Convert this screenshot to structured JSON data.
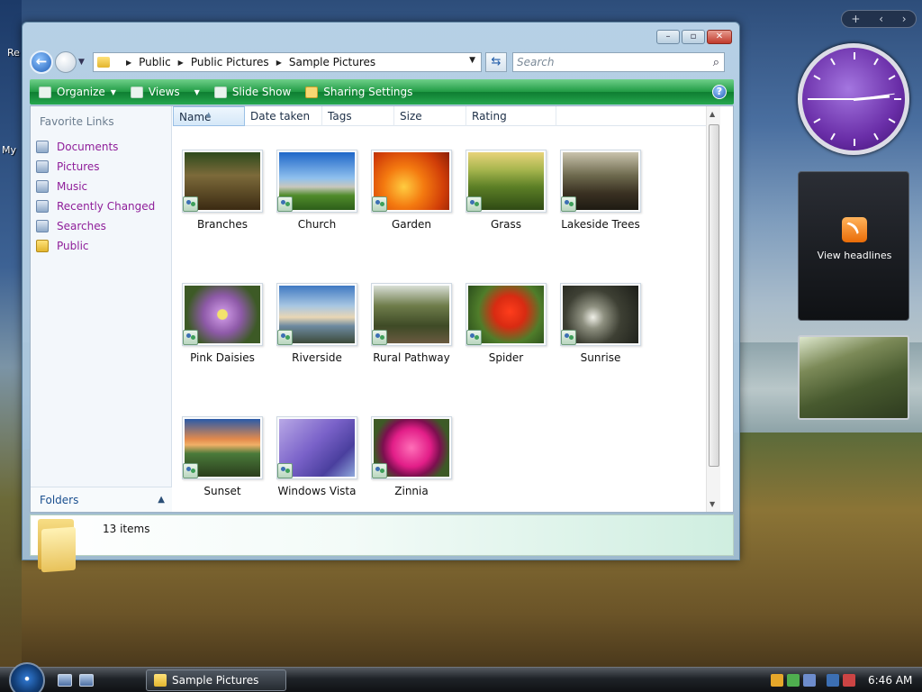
{
  "desktop": {
    "icon_label_1": "Re",
    "icon_label_2": "My"
  },
  "window": {
    "controls": {
      "minimize": "–",
      "maximize": "▫",
      "close": "✕"
    },
    "address": {
      "crumbs": [
        "Public",
        "Public Pictures",
        "Sample Pictures"
      ]
    },
    "search_placeholder": "Search",
    "toolbar": {
      "organize": "Organize",
      "views": "Views",
      "slideshow": "Slide Show",
      "sharing": "Sharing Settings"
    },
    "nav": {
      "heading": "Favorite Links",
      "items": [
        "Documents",
        "Pictures",
        "Music",
        "Recently Changed",
        "Searches",
        "Public"
      ],
      "folders_label": "Folders"
    },
    "columns": [
      "Name",
      "Date taken",
      "Tags",
      "Size",
      "Rating"
    ],
    "files": [
      {
        "name": "Branches",
        "gradient": "linear-gradient(180deg,#2d4a1c 0%,#7c6a3a 40%,#3b2a12 100%)"
      },
      {
        "name": "Church",
        "gradient": "linear-gradient(180deg,#1e66c8 0%,#8fc0ee 45%,#c8c7bd 60%,#4f8b2a 75%,#2d5e1a 100%)"
      },
      {
        "name": "Garden",
        "gradient": "radial-gradient(circle at 40% 60%,#ffcc40 0%,#f47a10 35%,#d13e08 70%,#8b1f06 100%)"
      },
      {
        "name": "Grass",
        "gradient": "linear-gradient(180deg,#e8d37a 0%,#a7b64e 30%,#5c7f26 60%,#2f4a14 100%)"
      },
      {
        "name": "Lakeside Trees",
        "gradient": "linear-gradient(180deg,#c9c3ad 0%,#6e6a4e 40%,#3b3223 70%,#1e1a12 100%)"
      },
      {
        "name": "Pink Daisies",
        "gradient": "radial-gradient(circle at 50% 50%,#f3e36b 0 10%,#c08bd8 12%,#8e5aa8 40%,#3d5a26 75%)"
      },
      {
        "name": "Riverside",
        "gradient": "linear-gradient(180deg,#3f79c2 0%,#a7c6e2 35%,#e9d6b4 55%,#6d8aa0 70%,#3c4a3a 100%)"
      },
      {
        "name": "Rural Pathway",
        "gradient": "linear-gradient(180deg,#d9dfd6 0%,#6e7c4a 35%,#3e4a26 70%,#6a5a40 100%)"
      },
      {
        "name": "Spider",
        "gradient": "radial-gradient(circle at 55% 45%,#ff3d1c 0%,#d82b12 30%,#4f7d2a 60%,#25451a 100%)"
      },
      {
        "name": "Sunrise",
        "gradient": "radial-gradient(circle at 40% 55%,#f0f0e8 0%,#8e9080 20%,#3e4034 50%,#1c1e18 100%)"
      },
      {
        "name": "Sunset",
        "gradient": "linear-gradient(180deg,#2a5aa8 0%,#e38a4c 35%,#f0b067 45%,#4a7a3a 60%,#2a3d1c 100%)"
      },
      {
        "name": "Windows Vista",
        "gradient": "linear-gradient(135deg,#b8a8e6 0%,#7a62c9 45%,#4a3f9e 75%,#8fa8dc 100%)"
      },
      {
        "name": "Zinnia",
        "gradient": "radial-gradient(circle at 50% 50%,#ff6fb8 0%,#e21e88 40%,#7c0f4f 60%,#3d5a26 80%)"
      }
    ],
    "status": {
      "item_count": "13 items"
    }
  },
  "sidebar": {
    "controls": [
      "+",
      "‹",
      "›"
    ],
    "news_label": "View headlines"
  },
  "taskbar": {
    "task_button": "Sample Pictures",
    "time": "6:46 AM"
  }
}
